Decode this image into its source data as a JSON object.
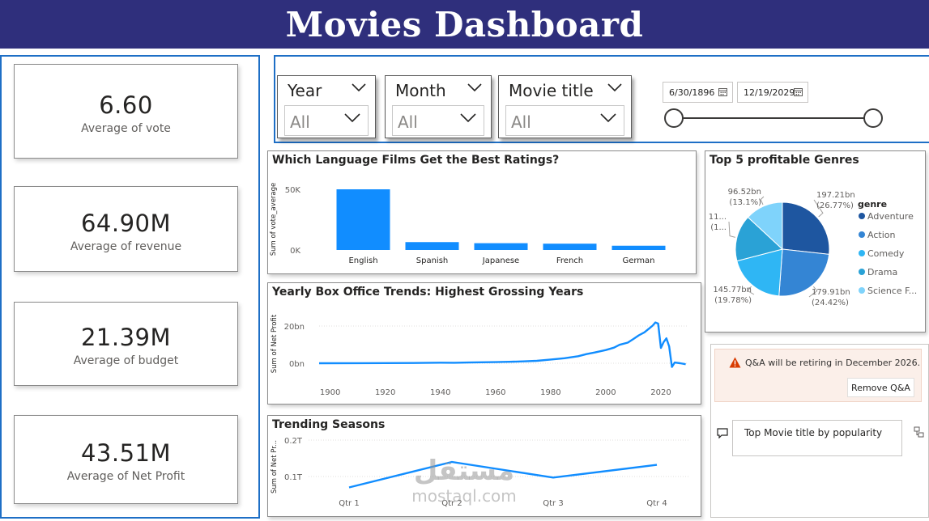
{
  "header": {
    "title": "Movies Dashboard"
  },
  "kpis": [
    {
      "value": "6.60",
      "label": "Average of vote"
    },
    {
      "value": "64.90M",
      "label": "Average of revenue"
    },
    {
      "value": "21.39M",
      "label": "Average of budget"
    },
    {
      "value": "43.51M",
      "label": "Average of Net Profit"
    }
  ],
  "filters": {
    "year": {
      "title": "Year",
      "value": "All"
    },
    "month": {
      "title": "Month",
      "value": "All"
    },
    "movie_title": {
      "title": "Movie title",
      "value": "All"
    },
    "date_range": {
      "start": "6/30/1896",
      "end": "12/19/2029"
    }
  },
  "chart_data": [
    {
      "type": "bar",
      "title": "Which Language Films Get the Best Ratings?",
      "ylabel": "Sum of vote_average",
      "xlabel": "",
      "categories": [
        "English",
        "Spanish",
        "Japanese",
        "French",
        "German"
      ],
      "values": [
        50000,
        6500,
        5600,
        5200,
        3500
      ],
      "ylim": [
        0,
        50000
      ],
      "yticks": [
        {
          "value": 50000,
          "label": "50K"
        },
        {
          "value": 0,
          "label": "0K"
        }
      ],
      "color": "#118dff"
    },
    {
      "type": "pie",
      "title": "Top 5 profitable Genres",
      "legend_title": "genre",
      "legend_placement": "right",
      "slices": [
        {
          "name": "Adventure",
          "value_label": "197.21bn",
          "pct_label": "(26.77%)",
          "value": 197.21,
          "color": "#1e56a0"
        },
        {
          "name": "Action",
          "value_label": "179.91bn",
          "pct_label": "(24.42%)",
          "value": 179.91,
          "color": "#3485d4"
        },
        {
          "name": "Comedy",
          "value_label": "145.77bn",
          "pct_label": "(19.78%)",
          "value": 145.77,
          "color": "#2fb6f4"
        },
        {
          "name": "Drama",
          "value_label": "11...",
          "pct_label": "(1...",
          "value": 117.6,
          "color": "#2aa2d6"
        },
        {
          "name": "Science F...",
          "value_label": "96.52bn",
          "pct_label": "(13.1%)",
          "value": 96.52,
          "color": "#7fd3fb"
        }
      ]
    },
    {
      "type": "line",
      "title": "Yearly Box Office Trends: Highest Grossing Years",
      "ylabel": "Sum of Net Profit",
      "xlabel": "",
      "xlim": [
        1896,
        2030
      ],
      "ylim": [
        0,
        22
      ],
      "yticks": [
        {
          "value": 20,
          "label": "20bn"
        },
        {
          "value": 0,
          "label": "0bn"
        }
      ],
      "xticks": [
        "1900",
        "1920",
        "1940",
        "1960",
        "1980",
        "2000",
        "2020"
      ],
      "x": [
        1896,
        1910,
        1920,
        1930,
        1940,
        1945,
        1950,
        1955,
        1960,
        1965,
        1970,
        1975,
        1980,
        1985,
        1990,
        1993,
        1996,
        2000,
        2003,
        2005,
        2008,
        2010,
        2012,
        2014,
        2016,
        2017,
        2018,
        2019,
        2020,
        2021,
        2022,
        2023,
        2024,
        2025,
        2027,
        2029
      ],
      "y": [
        0,
        0.05,
        0.1,
        0.15,
        0.3,
        0.25,
        0.4,
        0.5,
        0.6,
        0.8,
        1.0,
        1.3,
        2.0,
        2.7,
        3.8,
        4.9,
        5.8,
        7.1,
        8.4,
        9.9,
        11.1,
        13.0,
        15.0,
        16.6,
        19.0,
        20.2,
        21.9,
        21.3,
        8.2,
        11.4,
        13.4,
        9.0,
        -2.0,
        0.4,
        0.0,
        -0.5
      ],
      "color": "#118dff"
    },
    {
      "type": "line",
      "title": "Trending Seasons",
      "ylabel": "Sum of Net Pr...",
      "xlabel": "",
      "categories": [
        "Qtr 1",
        "Qtr 2",
        "Qtr 3",
        "Qtr 4"
      ],
      "values": [
        0.07,
        0.14,
        0.097,
        0.132
      ],
      "ylim": [
        0.03,
        0.22
      ],
      "yticks": [
        {
          "value": 0.2,
          "label": "0.2T"
        },
        {
          "value": 0.1,
          "label": "0.1T"
        }
      ],
      "color": "#118dff"
    }
  ],
  "qa": {
    "banner": "Q&A will be retiring in December 2026.",
    "remove_button": "Remove Q&A",
    "input_text": "Top Movie title by popularity"
  },
  "watermark": {
    "arabic": "مستقل",
    "latin": "mostaql.com"
  }
}
